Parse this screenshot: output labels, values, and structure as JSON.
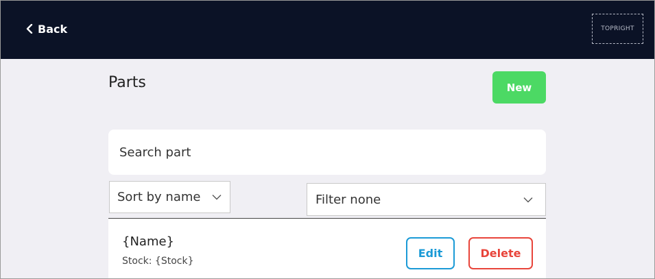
{
  "header": {
    "back_label": "Back",
    "topright_label": "TOPRIGHT"
  },
  "page": {
    "title": "Parts",
    "new_label": "New"
  },
  "search": {
    "placeholder": "Search part"
  },
  "sort": {
    "selected": "Sort by name"
  },
  "filter": {
    "selected": "Filter none"
  },
  "list": {
    "items": [
      {
        "name": "{Name}",
        "stock": "Stock: {Stock}",
        "edit_label": "Edit",
        "delete_label": "Delete"
      }
    ]
  },
  "colors": {
    "header_bg": "#0b1226",
    "page_bg": "#f0eff4",
    "new_button": "#4cd964",
    "edit_accent": "#1a9ad6",
    "delete_accent": "#e8443a"
  },
  "icons": {
    "back": "chevron-left-icon",
    "sort": "chevron-down-icon",
    "filter": "chevron-down-icon"
  }
}
